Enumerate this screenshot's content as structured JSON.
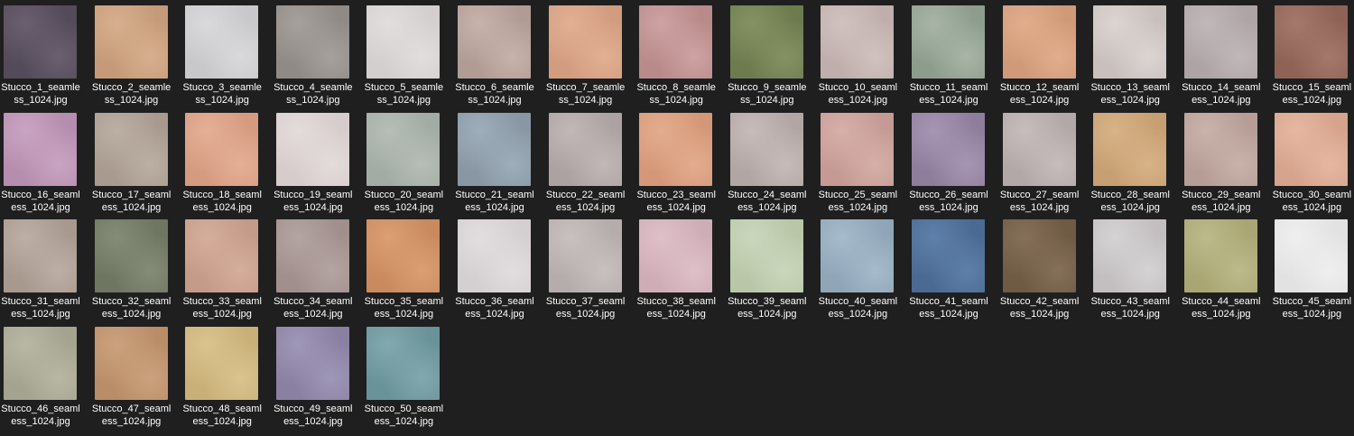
{
  "files": [
    {
      "line1": "Stucco_1_seamle",
      "line2": "ss_1024.jpg",
      "color": "#544b5a",
      "color2": "#6a6070"
    },
    {
      "line1": "Stucco_2_seamle",
      "line2": "ss_1024.jpg",
      "color": "#c49a78",
      "color2": "#d9b08f"
    },
    {
      "line1": "Stucco_3_seamle",
      "line2": "ss_1024.jpg",
      "color": "#c8c8ca",
      "color2": "#dadadc"
    },
    {
      "line1": "Stucco_4_seamle",
      "line2": "ss_1024.jpg",
      "color": "#8f8a86",
      "color2": "#a6a19c"
    },
    {
      "line1": "Stucco_5_seamle",
      "line2": "ss_1024.jpg",
      "color": "#d4cfcf",
      "color2": "#e2dede"
    },
    {
      "line1": "Stucco_6_seamle",
      "line2": "ss_1024.jpg",
      "color": "#b09c94",
      "color2": "#c7b3aa"
    },
    {
      "line1": "Stucco_7_seamle",
      "line2": "ss_1024.jpg",
      "color": "#d29c7f",
      "color2": "#e3b094"
    },
    {
      "line1": "Stucco_8_seamle",
      "line2": "ss_1024.jpg",
      "color": "#b88a8a",
      "color2": "#cfa3a3"
    },
    {
      "line1": "Stucco_9_seamle",
      "line2": "ss_1024.jpg",
      "color": "#6d7b4f",
      "color2": "#859364"
    },
    {
      "line1": "Stucco_10_seaml",
      "line2": "ess_1024.jpg",
      "color": "#bfaeac",
      "color2": "#d1c2c0"
    },
    {
      "line1": "Stucco_11_seaml",
      "line2": "ess_1024.jpg",
      "color": "#8e9c8e",
      "color2": "#a8b5a7"
    },
    {
      "line1": "Stucco_12_seaml",
      "line2": "ess_1024.jpg",
      "color": "#d09a78",
      "color2": "#e1ae8d"
    },
    {
      "line1": "Stucco_13_seaml",
      "line2": "ess_1024.jpg",
      "color": "#c9c0bd",
      "color2": "#dcd5d2"
    },
    {
      "line1": "Stucco_14_seaml",
      "line2": "ess_1024.jpg",
      "color": "#aea4a6",
      "color2": "#c1b8ba"
    },
    {
      "line1": "Stucco_15_seaml",
      "line2": "ess_1024.jpg",
      "color": "#8e6356",
      "color2": "#a5796b"
    },
    {
      "line1": "Stucco_16_seaml",
      "line2": "ess_1024.jpg",
      "color": "#b58dae",
      "color2": "#caa5c2"
    },
    {
      "line1": "Stucco_17_seaml",
      "line2": "ess_1024.jpg",
      "color": "#a89a8e",
      "color2": "#bcb0a5"
    },
    {
      "line1": "Stucco_18_seaml",
      "line2": "ess_1024.jpg",
      "color": "#d59b80",
      "color2": "#e5b097"
    },
    {
      "line1": "Stucco_19_seaml",
      "line2": "ess_1024.jpg",
      "color": "#d6cccb",
      "color2": "#e4dcdb"
    },
    {
      "line1": "Stucco_20_seaml",
      "line2": "ess_1024.jpg",
      "color": "#a2aba4",
      "color2": "#b7beb8"
    },
    {
      "line1": "Stucco_21_seaml",
      "line2": "ess_1024.jpg",
      "color": "#8897a3",
      "color2": "#9faebb"
    },
    {
      "line1": "Stucco_22_seaml",
      "line2": "ess_1024.jpg",
      "color": "#ada2a2",
      "color2": "#c2b8b8"
    },
    {
      "line1": "Stucco_23_seaml",
      "line2": "ess_1024.jpg",
      "color": "#d49878",
      "color2": "#e4ad8f"
    },
    {
      "line1": "Stucco_24_seaml",
      "line2": "ess_1024.jpg",
      "color": "#b2a6a4",
      "color2": "#c6bcba"
    },
    {
      "line1": "Stucco_25_seaml",
      "line2": "ess_1024.jpg",
      "color": "#c59a94",
      "color2": "#d7b0aa"
    },
    {
      "line1": "Stucco_26_seaml",
      "line2": "ess_1024.jpg",
      "color": "#8f7d9c",
      "color2": "#a796b3"
    },
    {
      "line1": "Stucco_27_seaml",
      "line2": "ess_1024.jpg",
      "color": "#b3a8a8",
      "color2": "#c7bdbd"
    },
    {
      "line1": "Stucco_28_seaml",
      "line2": "ess_1024.jpg",
      "color": "#c6a072",
      "color2": "#d8b388"
    },
    {
      "line1": "Stucco_29_seaml",
      "line2": "ess_1024.jpg",
      "color": "#b69e96",
      "color2": "#c9b3ab"
    },
    {
      "line1": "Stucco_30_seaml",
      "line2": "ess_1024.jpg",
      "color": "#d6a38c",
      "color2": "#e6b8a2"
    },
    {
      "line1": "Stucco_31_seaml",
      "line2": "ess_1024.jpg",
      "color": "#a8998f",
      "color2": "#bdafa5"
    },
    {
      "line1": "Stucco_32_seaml",
      "line2": "ess_1024.jpg",
      "color": "#6e7561",
      "color2": "#858c77"
    },
    {
      "line1": "Stucco_33_seaml",
      "line2": "ess_1024.jpg",
      "color": "#c49a88",
      "color2": "#d6ae9c"
    },
    {
      "line1": "Stucco_34_seaml",
      "line2": "ess_1024.jpg",
      "color": "#a08f8c",
      "color2": "#b5a5a2"
    },
    {
      "line1": "Stucco_35_seaml",
      "line2": "ess_1024.jpg",
      "color": "#c98a5e",
      "color2": "#db9f74"
    },
    {
      "line1": "Stucco_36_seaml",
      "line2": "ess_1024.jpg",
      "color": "#d4cfd0",
      "color2": "#e2dedf"
    },
    {
      "line1": "Stucco_37_seaml",
      "line2": "ess_1024.jpg",
      "color": "#b5adac",
      "color2": "#c8c1c0"
    },
    {
      "line1": "Stucco_38_seaml",
      "line2": "ess_1024.jpg",
      "color": "#cfadb6",
      "color2": "#dfc0c8"
    },
    {
      "line1": "Stucco_39_seaml",
      "line2": "ess_1024.jpg",
      "color": "#b9c7a8",
      "color2": "#cbd7bd"
    },
    {
      "line1": "Stucco_40_seaml",
      "line2": "ess_1024.jpg",
      "color": "#8fa6b8",
      "color2": "#a6bbcb"
    },
    {
      "line1": "Stucco_41_seaml",
      "line2": "ess_1024.jpg",
      "color": "#4a6a93",
      "color2": "#5f80aa"
    },
    {
      "line1": "Stucco_42_seaml",
      "line2": "ess_1024.jpg",
      "color": "#6f5a44",
      "color2": "#85705a"
    },
    {
      "line1": "Stucco_43_seaml",
      "line2": "ess_1024.jpg",
      "color": "#c3bfc0",
      "color2": "#d6d3d4"
    },
    {
      "line1": "Stucco_44_seaml",
      "line2": "ess_1024.jpg",
      "color": "#a9a674",
      "color2": "#bdba8b"
    },
    {
      "line1": "Stucco_45_seaml",
      "line2": "ess_1024.jpg",
      "color": "#e2e2e2",
      "color2": "#efefef"
    },
    {
      "line1": "Stucco_46_seaml",
      "line2": "ess_1024.jpg",
      "color": "#a3a38f",
      "color2": "#b8b8a5"
    },
    {
      "line1": "Stucco_47_seaml",
      "line2": "ess_1024.jpg",
      "color": "#b98d68",
      "color2": "#cca27e"
    },
    {
      "line1": "Stucco_48_seaml",
      "line2": "ess_1024.jpg",
      "color": "#c9b078",
      "color2": "#dbc48f"
    },
    {
      "line1": "Stucco_49_seaml",
      "line2": "ess_1024.jpg",
      "color": "#8a80a2",
      "color2": "#a098b8"
    },
    {
      "line1": "Stucco_50_seaml",
      "line2": "ess_1024.jpg",
      "color": "#6a9299",
      "color2": "#82a9af"
    }
  ]
}
